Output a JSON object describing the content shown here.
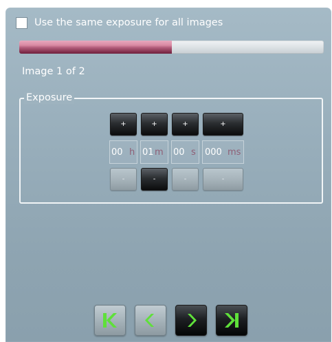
{
  "options": {
    "same_exposure_label": "Use the same exposure for all images",
    "same_exposure_checked": false
  },
  "progress": {
    "fraction": 0.5
  },
  "image_counter": "Image 1 of 2",
  "exposure": {
    "legend": "Exposure",
    "increment_label": "+",
    "decrement_label": "-",
    "fields": [
      {
        "value": "00",
        "unit": "h"
      },
      {
        "value": "01",
        "unit": "m"
      },
      {
        "value": "00",
        "unit": "s"
      },
      {
        "value": "000",
        "unit": "ms"
      }
    ]
  },
  "navigation": {
    "first_icon": "first-image-icon",
    "previous_icon": "previous-image-icon",
    "next_icon": "next-image-icon",
    "last_icon": "last-image-icon",
    "icon_color": "#5fe03a"
  }
}
